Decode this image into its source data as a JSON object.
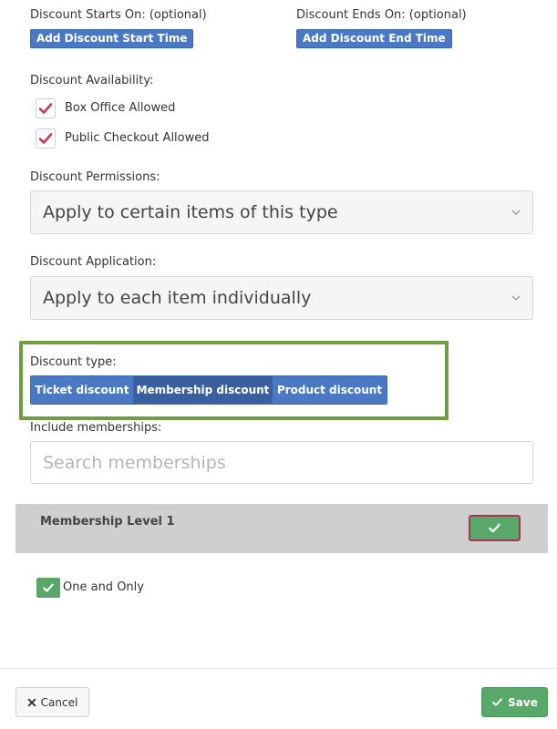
{
  "discount_start": {
    "label": "Discount Starts On: (optional)",
    "button": "Add Discount Start Time"
  },
  "discount_end": {
    "label": "Discount Ends On: (optional)",
    "button": "Add Discount End Time"
  },
  "availability": {
    "label": "Discount Availability:",
    "options": [
      {
        "label": "Box Office Allowed",
        "checked": true
      },
      {
        "label": "Public Checkout Allowed",
        "checked": true
      }
    ]
  },
  "permissions": {
    "label": "Discount Permissions:",
    "selected": "Apply to certain items of this type"
  },
  "application": {
    "label": "Discount Application:",
    "selected": "Apply to each item individually"
  },
  "discount_type": {
    "label": "Discount type:",
    "options": [
      "Ticket discount",
      "Membership discount",
      "Product discount"
    ],
    "active": "Membership discount"
  },
  "memberships": {
    "label": "Include memberships:",
    "placeholder": "Search memberships",
    "value": ""
  },
  "membership_row": {
    "name": "Membership Level 1"
  },
  "option_checkbox": {
    "label": "One and Only",
    "checked": true
  },
  "footer": {
    "cancel_label": "Cancel",
    "save_label": "Save"
  },
  "colors": {
    "primary_blue": "#4a78c2",
    "active_blue": "#3a5f9e",
    "highlight_green": "#6f9e3e",
    "success_green": "#5aa76a",
    "check_red": "#c8354f"
  }
}
